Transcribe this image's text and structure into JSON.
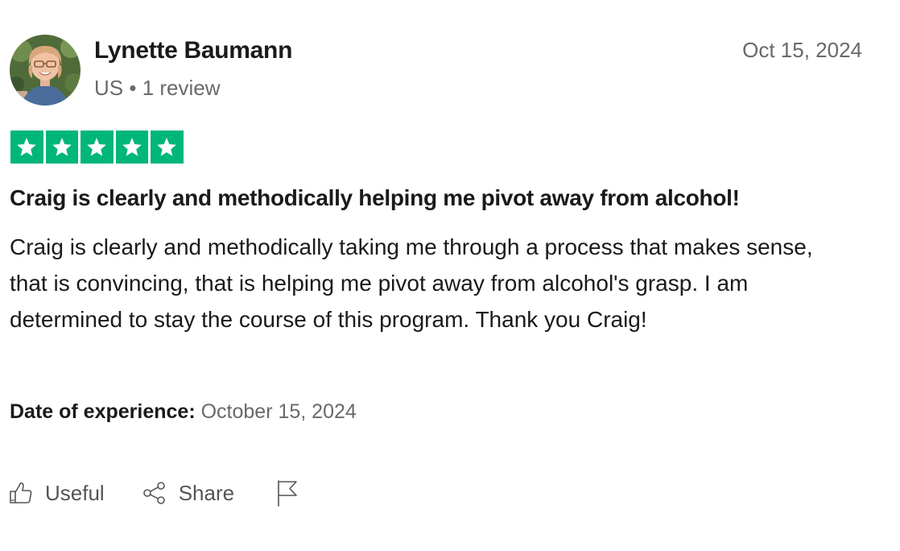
{
  "reviewer": {
    "name": "Lynette Baumann",
    "country": "US",
    "separator": "•",
    "review_count": "1 review",
    "avatar_icon": "user-photo-avatar"
  },
  "review": {
    "date": "Oct 15, 2024",
    "rating": 5,
    "max_rating": 5,
    "star_color": "#00b67a",
    "title": "Craig is clearly and methodically helping me pivot away from alcohol!",
    "body": "Craig is clearly and methodically taking me through a process that makes sense, that is convincing, that is helping me pivot away from alcohol's grasp. I am determined to stay the course of this program. Thank you Craig!",
    "experience_label": "Date of experience:",
    "experience_date": "October 15, 2024"
  },
  "actions": {
    "useful_label": "Useful",
    "useful_icon": "thumbs-up-icon",
    "share_label": "Share",
    "share_icon": "share-icon",
    "report_icon": "flag-icon"
  },
  "colors": {
    "text_primary": "#1a1a1a",
    "text_secondary": "#696969",
    "star_green": "#00b67a"
  }
}
